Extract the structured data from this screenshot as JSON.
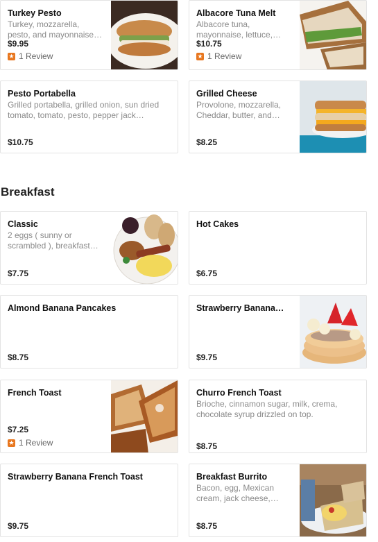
{
  "sections": [
    {
      "items": [
        {
          "name": "Turkey Pesto",
          "desc": "Turkey, mozzarella, pesto, and mayonnaise on…",
          "price": "$9.95",
          "review": "1 Review"
        },
        {
          "name": "Albacore Tuna Melt",
          "desc": "Albacore tuna, mayonnaise, lettuce,…",
          "price": "$10.75",
          "review": "1 Review"
        },
        {
          "name": "Pesto Portabella",
          "desc": "Grilled portabella, grilled onion, sun dried tomato, tomato, pesto, pepper jack cheese,…",
          "price": "$10.75"
        },
        {
          "name": "Grilled Cheese",
          "desc": "Provolone, mozzarella, Cheddar, butter, and…",
          "price": "$8.25"
        }
      ]
    },
    {
      "title": "Breakfast",
      "items": [
        {
          "name": "Classic",
          "desc": "2 eggs ( sunny or scrambled ), breakfast…",
          "price": "$7.75"
        },
        {
          "name": "Hot Cakes",
          "desc": "",
          "price": "$6.75"
        },
        {
          "name": "Almond Banana Pancakes",
          "desc": "",
          "price": "$8.75"
        },
        {
          "name": "Strawberry Banana…",
          "desc": "",
          "price": "$9.75"
        },
        {
          "name": "French Toast",
          "desc": "",
          "price": "$7.25",
          "review": "1 Review"
        },
        {
          "name": "Churro French Toast",
          "desc": "Brioche, cinnamon sugar, milk, crema, chocolate syrup drizzled on top.",
          "price": "$8.75"
        },
        {
          "name": "Strawberry Banana French Toast",
          "desc": "",
          "price": "$9.75"
        },
        {
          "name": "Breakfast Burrito",
          "desc": "Bacon, egg, Mexican cream, jack cheese,…",
          "price": "$8.75"
        }
      ]
    }
  ],
  "icons": {
    "review": "star-icon"
  },
  "colors": {
    "review_star": "#e8771f",
    "price": "#222222",
    "description": "#8a8a8a"
  }
}
